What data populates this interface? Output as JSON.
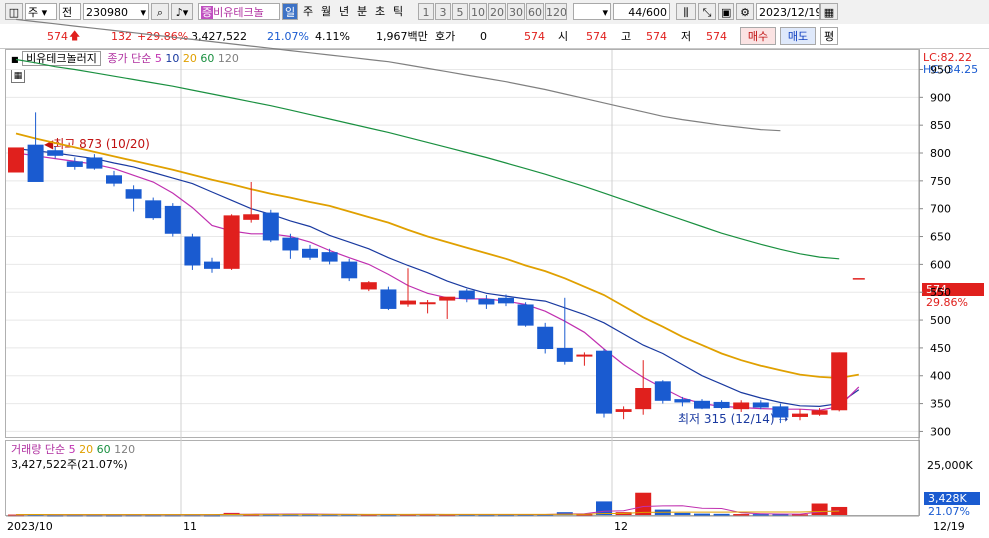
{
  "toolbar": {
    "market": "주",
    "scope": "전",
    "code": "230980",
    "stock_name": "비유테크놀",
    "periods": [
      "일",
      "주",
      "월",
      "년",
      "분",
      "초",
      "틱"
    ],
    "active_period": "일",
    "intervals": [
      "1",
      "3",
      "5",
      "10",
      "20",
      "30",
      "60",
      "120"
    ],
    "count": "44",
    "count_max": "/600",
    "date": "2023/12/19"
  },
  "quote": {
    "price": "574",
    "arrow": "🡅",
    "change": "132",
    "change_pct": "+29.86%",
    "volume": "3,427,522",
    "turnover": "21.07%",
    "ratio": "4.11%",
    "amount": "1,967백만",
    "bid_label": "호가",
    "bid_value": "0",
    "level_value": "574",
    "open_label": "시",
    "open": "574",
    "high_label": "고",
    "high": "574",
    "low_label": "저",
    "low": "574",
    "buy_label": "매수",
    "sell_label": "매도",
    "eval_label": "평"
  },
  "legend": {
    "name": "비유테크놀러지",
    "ma_label": "종가 단순",
    "ma": [
      "5",
      "10",
      "20",
      "60",
      "120"
    ],
    "ma_colors": [
      "#c030b0",
      "#1a3aa0",
      "#e0a000",
      "#1a9040",
      "#808080"
    ]
  },
  "volume_legend": {
    "label": "거래량 단순",
    "ma": [
      "5",
      "20",
      "60",
      "120"
    ],
    "value": "3,427,522주(21.07%)"
  },
  "right_axis": {
    "lc": "LC:82.22",
    "hc": "HC:-34.25",
    "price_tag": "574",
    "pct_tag": "29.86%",
    "vol_tag": "3,428K",
    "vol_pct": "21.07%",
    "vol_tick": "25,000K"
  },
  "annotations": {
    "high": "최고 873 (10/20)",
    "low": "최저 315 (12/14)"
  },
  "x_labels": {
    "start": "2023/10",
    "nov": "11",
    "dec": "12",
    "end": "12/19"
  },
  "chart_data": {
    "type": "candlestick",
    "y_ticks": [
      300,
      350,
      400,
      450,
      500,
      550,
      600,
      650,
      700,
      750,
      800,
      850,
      900,
      950
    ],
    "ylim": [
      290,
      985
    ],
    "candles": [
      {
        "o": 765,
        "h": 810,
        "l": 765,
        "c": 810
      },
      {
        "o": 815,
        "h": 873,
        "l": 750,
        "c": 748
      },
      {
        "o": 805,
        "h": 812,
        "l": 790,
        "c": 795
      },
      {
        "o": 785,
        "h": 792,
        "l": 770,
        "c": 775
      },
      {
        "o": 792,
        "h": 798,
        "l": 770,
        "c": 772
      },
      {
        "o": 760,
        "h": 768,
        "l": 740,
        "c": 745
      },
      {
        "o": 735,
        "h": 742,
        "l": 695,
        "c": 718
      },
      {
        "o": 715,
        "h": 720,
        "l": 680,
        "c": 683
      },
      {
        "o": 705,
        "h": 710,
        "l": 650,
        "c": 655
      },
      {
        "o": 650,
        "h": 655,
        "l": 590,
        "c": 598
      },
      {
        "o": 605,
        "h": 612,
        "l": 585,
        "c": 592
      },
      {
        "o": 592,
        "h": 690,
        "l": 590,
        "c": 688
      },
      {
        "o": 680,
        "h": 748,
        "l": 675,
        "c": 690
      },
      {
        "o": 693,
        "h": 698,
        "l": 640,
        "c": 643
      },
      {
        "o": 648,
        "h": 655,
        "l": 610,
        "c": 625
      },
      {
        "o": 628,
        "h": 635,
        "l": 608,
        "c": 612
      },
      {
        "o": 622,
        "h": 628,
        "l": 600,
        "c": 605
      },
      {
        "o": 605,
        "h": 610,
        "l": 570,
        "c": 575
      },
      {
        "o": 555,
        "h": 570,
        "l": 552,
        "c": 568
      },
      {
        "o": 555,
        "h": 560,
        "l": 518,
        "c": 520
      },
      {
        "o": 528,
        "h": 593,
        "l": 524,
        "c": 535
      },
      {
        "o": 530,
        "h": 536,
        "l": 512,
        "c": 532
      },
      {
        "o": 535,
        "h": 540,
        "l": 502,
        "c": 542
      },
      {
        "o": 553,
        "h": 556,
        "l": 532,
        "c": 538
      },
      {
        "o": 538,
        "h": 545,
        "l": 520,
        "c": 528
      },
      {
        "o": 540,
        "h": 546,
        "l": 525,
        "c": 530
      },
      {
        "o": 528,
        "h": 532,
        "l": 488,
        "c": 490
      },
      {
        "o": 488,
        "h": 495,
        "l": 440,
        "c": 448
      },
      {
        "o": 450,
        "h": 540,
        "l": 420,
        "c": 425
      },
      {
        "o": 435,
        "h": 442,
        "l": 418,
        "c": 438
      },
      {
        "o": 445,
        "h": 448,
        "l": 325,
        "c": 332
      },
      {
        "o": 335,
        "h": 345,
        "l": 322,
        "c": 340
      },
      {
        "o": 340,
        "h": 428,
        "l": 330,
        "c": 378
      },
      {
        "o": 390,
        "h": 392,
        "l": 350,
        "c": 355
      },
      {
        "o": 358,
        "h": 362,
        "l": 345,
        "c": 352
      },
      {
        "o": 355,
        "h": 358,
        "l": 340,
        "c": 341
      },
      {
        "o": 353,
        "h": 356,
        "l": 340,
        "c": 342
      },
      {
        "o": 340,
        "h": 356,
        "l": 335,
        "c": 352
      },
      {
        "o": 352,
        "h": 356,
        "l": 340,
        "c": 343
      },
      {
        "o": 345,
        "h": 350,
        "l": 315,
        "c": 325
      },
      {
        "o": 326,
        "h": 340,
        "l": 320,
        "c": 332
      },
      {
        "o": 330,
        "h": 342,
        "l": 328,
        "c": 338
      },
      {
        "o": 338,
        "h": 442,
        "l": 336,
        "c": 442
      },
      {
        "o": 574,
        "h": 574,
        "l": 574,
        "c": 574
      }
    ],
    "volume_units": "K",
    "volume": [
      180,
      210,
      140,
      160,
      150,
      130,
      170,
      150,
      160,
      180,
      140,
      900,
      420,
      360,
      250,
      220,
      210,
      240,
      200,
      180,
      260,
      300,
      200,
      220,
      180,
      190,
      300,
      260,
      1200,
      520,
      5800,
      1200,
      9500,
      2300,
      900,
      600,
      500,
      400,
      380,
      350,
      300,
      4900,
      3428
    ],
    "ma": {
      "5": [
        800,
        795,
        790,
        785,
        780,
        772,
        760,
        748,
        728,
        702,
        670,
        660,
        655,
        655,
        650,
        640,
        625,
        612,
        600,
        582,
        562,
        548,
        540,
        538,
        538,
        534,
        528,
        516,
        498,
        478,
        448,
        420,
        397,
        378,
        360,
        350,
        345,
        343,
        341,
        340,
        340,
        338,
        345,
        380
      ],
      "10": [
        808,
        804,
        800,
        795,
        790,
        782,
        775,
        765,
        755,
        745,
        730,
        715,
        700,
        690,
        678,
        668,
        652,
        640,
        628,
        612,
        598,
        585,
        570,
        558,
        548,
        543,
        538,
        534,
        522,
        510,
        495,
        475,
        455,
        440,
        420,
        400,
        385,
        370,
        360,
        352,
        346,
        345,
        350,
        375
      ],
      "20": [
        835,
        826,
        818,
        810,
        802,
        794,
        786,
        778,
        770,
        761,
        752,
        744,
        735,
        727,
        720,
        712,
        705,
        695,
        685,
        675,
        662,
        650,
        640,
        630,
        620,
        610,
        598,
        588,
        575,
        560,
        545,
        525,
        505,
        488,
        470,
        455,
        440,
        428,
        418,
        410,
        402,
        398,
        396,
        402
      ],
      "60": [
        968,
        962,
        955,
        950,
        944,
        938,
        932,
        926,
        920,
        913,
        906,
        899,
        892,
        885,
        877,
        869,
        861,
        853,
        845,
        837,
        828,
        819,
        810,
        801,
        792,
        782,
        772,
        762,
        751,
        740,
        728,
        716,
        704,
        692,
        680,
        668,
        656,
        646,
        636,
        627,
        619,
        613,
        610
      ],
      "120": [
        1040,
        1036,
        1032,
        1028,
        1024,
        1020,
        1016,
        1012,
        1008,
        1004,
        1000,
        996,
        992,
        988,
        984,
        980,
        976,
        972,
        968,
        964,
        958,
        952,
        946,
        940,
        934,
        928,
        921,
        914,
        906,
        898,
        890,
        882,
        874,
        866,
        860,
        855,
        850,
        846,
        842,
        840
      ]
    }
  }
}
